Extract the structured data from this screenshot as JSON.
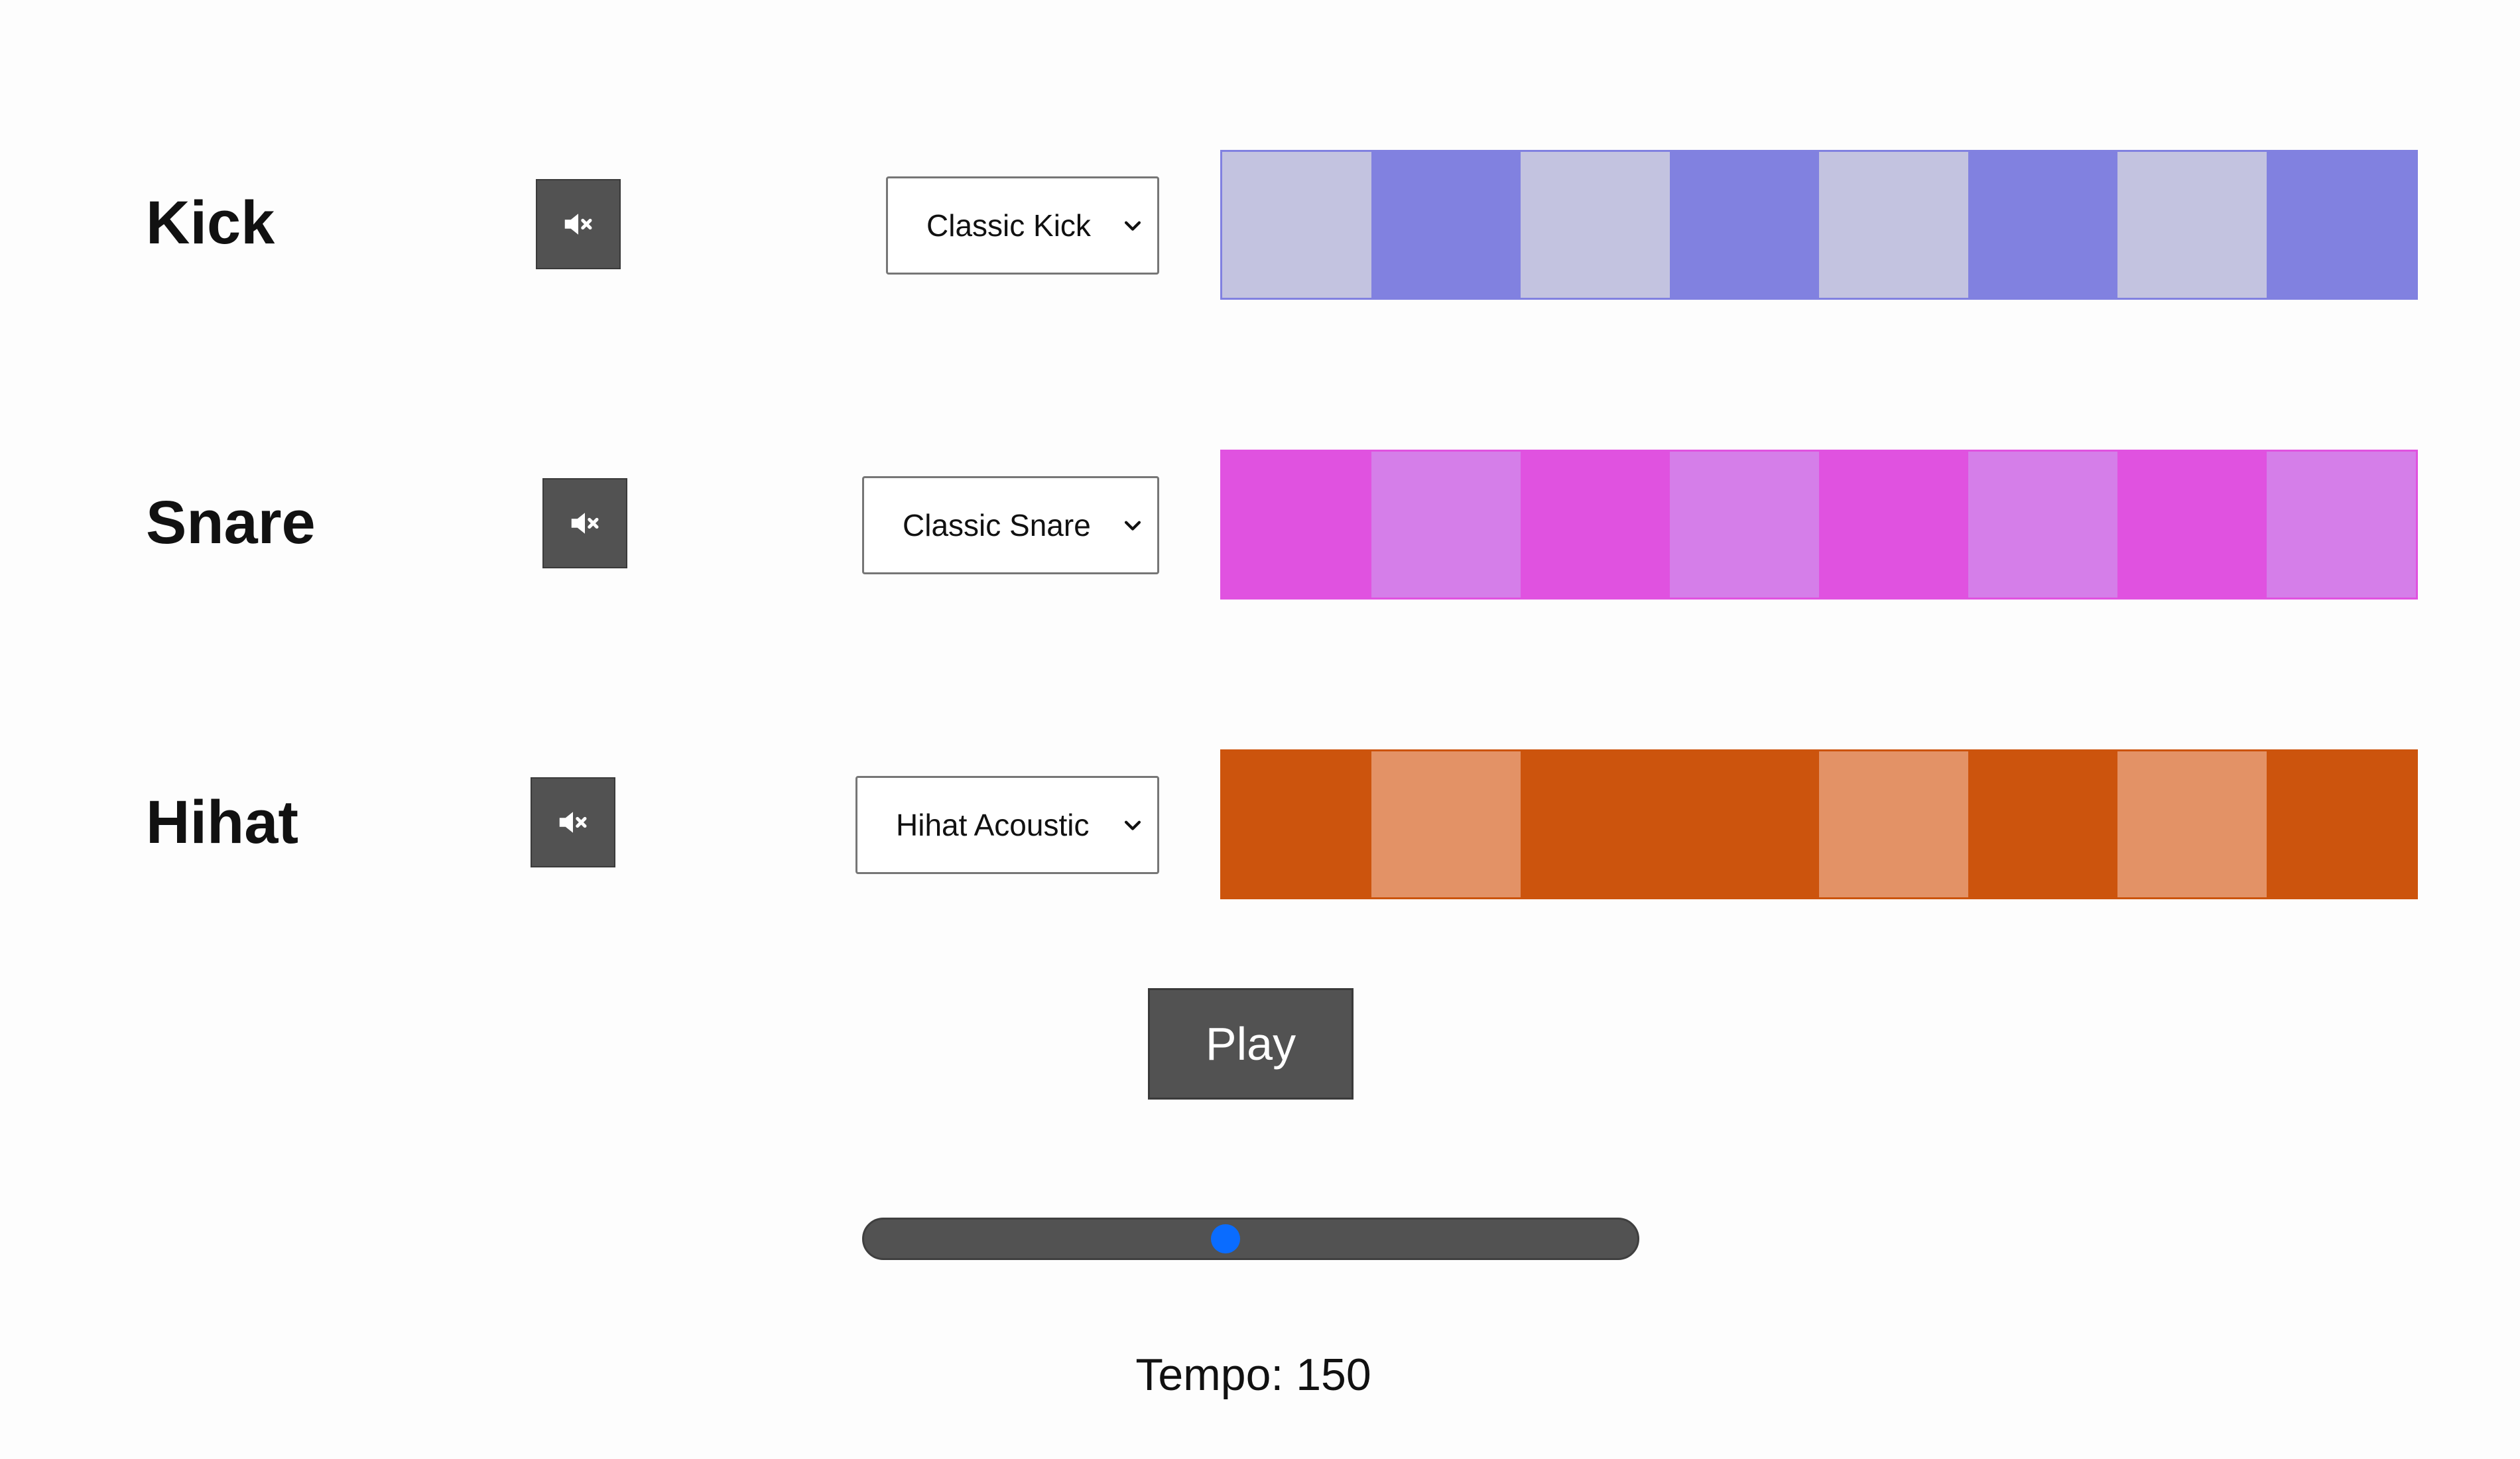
{
  "tracks": [
    {
      "name": "Kick",
      "sound": "Classic Kick",
      "mute_icon": "muted-speaker-icon",
      "pads_on": [
        false,
        true,
        false,
        true,
        false,
        true,
        false,
        true
      ],
      "color_on": "#8181e0",
      "color_off": "#c3c3e0"
    },
    {
      "name": "Snare",
      "sound": "Classic Snare",
      "mute_icon": "muted-speaker-icon",
      "pads_on": [
        true,
        false,
        true,
        false,
        true,
        false,
        true,
        false
      ],
      "color_on": "#e052e0",
      "color_off": "#d57ee9"
    },
    {
      "name": "Hihat",
      "sound": "Hihat Acoustic",
      "mute_icon": "muted-speaker-icon",
      "pads_on": [
        true,
        false,
        true,
        true,
        false,
        true,
        false,
        true
      ],
      "color_on": "#cc540d",
      "color_off": "#e39266"
    }
  ],
  "transport": {
    "play_label": "Play"
  },
  "tempo": {
    "label": "Tempo: 150",
    "value": 150,
    "slider_fraction": 0.467,
    "thumb_color": "#0a6cff"
  }
}
